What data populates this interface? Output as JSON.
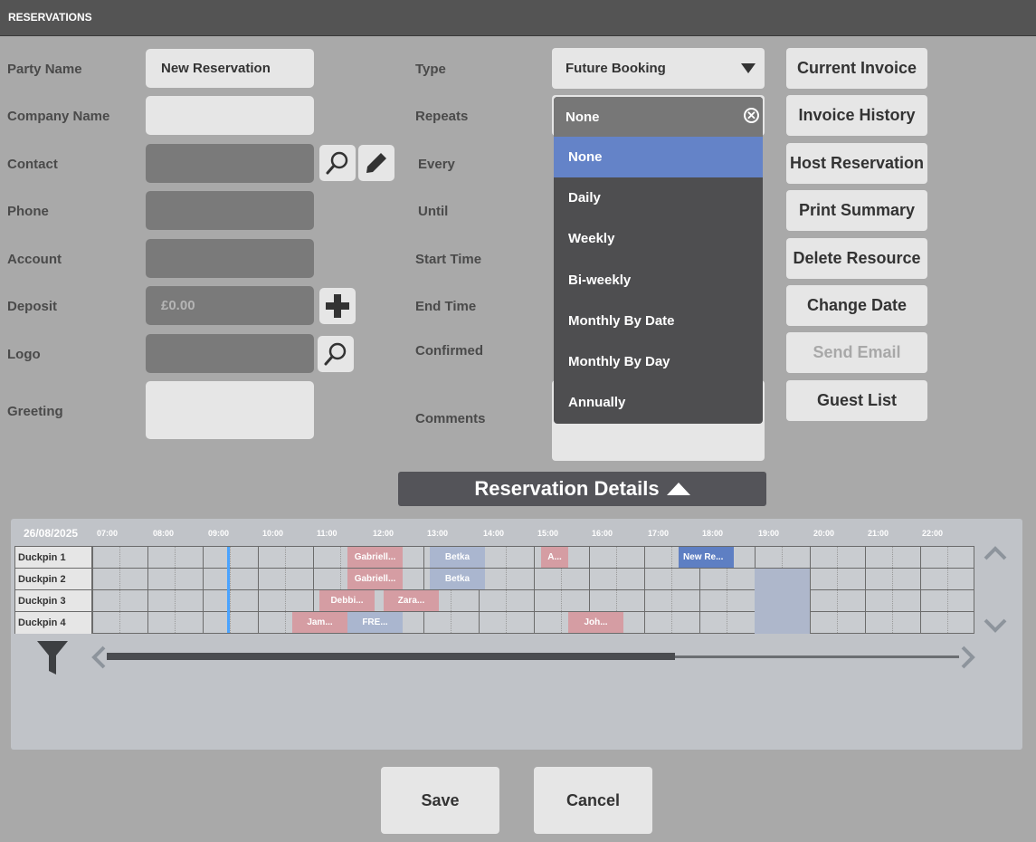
{
  "window": {
    "title": "RESERVATIONS"
  },
  "form": {
    "party_name_label": "Party Name",
    "party_name_value": "New Reservation",
    "company_name_label": "Company Name",
    "company_name_value": "",
    "contact_label": "Contact",
    "phone_label": "Phone",
    "account_label": "Account",
    "deposit_label": "Deposit",
    "deposit_value": "£0.00",
    "logo_label": "Logo",
    "greeting_label": "Greeting",
    "type_label": "Type",
    "type_value": "Future Booking",
    "repeats_label": "Repeats",
    "every_label": "Every",
    "until_label": "Until",
    "start_time_label": "Start Time",
    "end_time_label": "End Time",
    "confirmed_label": "Confirmed",
    "comments_label": "Comments"
  },
  "repeats_dropdown": {
    "selected": "None",
    "options": [
      "None",
      "Daily",
      "Weekly",
      "Bi-weekly",
      "Monthly By Date",
      "Monthly By Day",
      "Annually"
    ],
    "highlight_color": "#6483c8"
  },
  "actions": {
    "current_invoice": "Current Invoice",
    "invoice_history": "Invoice History",
    "host_reservation": "Host Reservation",
    "print_summary": "Print Summary",
    "delete_resource": "Delete Resource",
    "change_date": "Change Date",
    "send_email": "Send Email",
    "guest_list": "Guest List"
  },
  "details_toggle": {
    "label": "Reservation Details"
  },
  "timeline": {
    "date": "26/08/2025",
    "hours": [
      "07:00",
      "08:00",
      "09:00",
      "10:00",
      "11:00",
      "12:00",
      "13:00",
      "14:00",
      "15:00",
      "16:00",
      "17:00",
      "18:00",
      "19:00",
      "20:00",
      "21:00",
      "22:00"
    ],
    "lanes": [
      "Duckpin 1",
      "Duckpin 2",
      "Duckpin 3",
      "Duckpin 4"
    ],
    "bookings": [
      {
        "lane": 0,
        "label": "Gabriell...",
        "style": "red"
      },
      {
        "lane": 0,
        "label": "Betka",
        "style": "blue"
      },
      {
        "lane": 0,
        "label": "A...",
        "style": "red"
      },
      {
        "lane": 0,
        "label": "New Re...",
        "style": "new"
      },
      {
        "lane": 1,
        "label": "Gabriell...",
        "style": "red"
      },
      {
        "lane": 1,
        "label": "Betka",
        "style": "blue"
      },
      {
        "lane": 2,
        "label": "Debbi...",
        "style": "red"
      },
      {
        "lane": 2,
        "label": "Zara...",
        "style": "red"
      },
      {
        "lane": 3,
        "label": "Jam...",
        "style": "red"
      },
      {
        "lane": 3,
        "label": "FRE...",
        "style": "blue"
      },
      {
        "lane": 3,
        "label": "Joh...",
        "style": "red"
      }
    ],
    "colors": {
      "booked": "#d59da3",
      "other": "#aab6cf",
      "new": "#5e7fc3",
      "now": "#4aa3ff"
    }
  },
  "footer": {
    "save": "Save",
    "cancel": "Cancel"
  },
  "icons": [
    "search-icon",
    "pencil-icon",
    "plus-icon",
    "clear-icon",
    "caret-down-icon",
    "caret-up-icon",
    "filter-icon",
    "chevron-left-icon",
    "chevron-right-icon",
    "chevron-up-icon",
    "chevron-down-icon"
  ]
}
